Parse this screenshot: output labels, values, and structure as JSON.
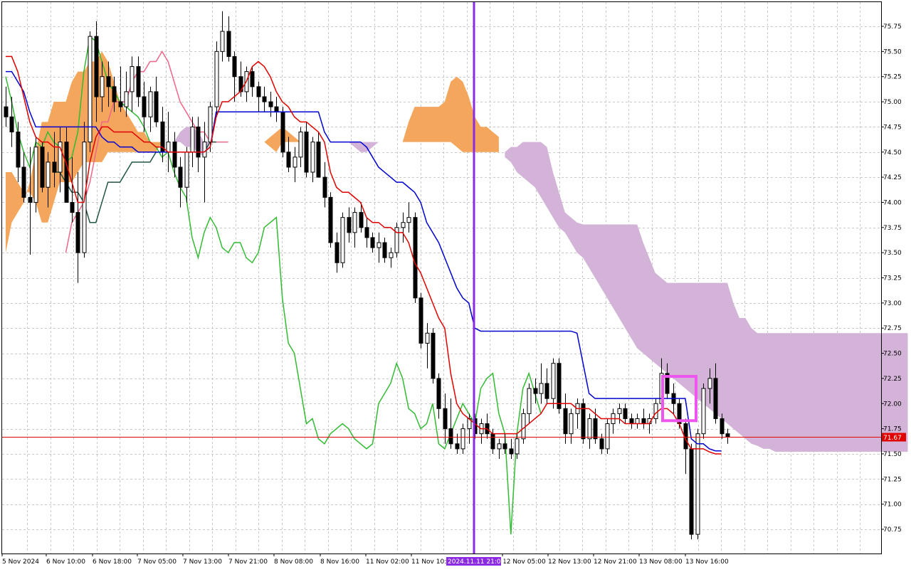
{
  "colors": {
    "background": "#ffffff",
    "grid": "#c8c8c8",
    "tenkan": "#e00000",
    "kijun": "#0000d0",
    "chikou": "#33bb33",
    "senkou_a": "#ee6688",
    "senkou_b": "#225544",
    "kumo_bull": "#f4a65c",
    "kumo_bear": "#d3b4d8",
    "candle_up_body": "#ffffff",
    "candle_down_body": "#000000",
    "candle_outline": "#000000",
    "vertical_marker": "#8a2be2",
    "highlight_box": "#ee55ee",
    "current_price_line": "#e00000",
    "current_price_badge": "#e00000"
  },
  "chart_data": {
    "type": "candlestick",
    "indicator": "Ichimoku Kinko Hyo",
    "ylim": [
      70.55,
      75.95
    ],
    "y_ticks": [
      "75.75",
      "75.50",
      "75.25",
      "75.00",
      "74.75",
      "74.50",
      "74.25",
      "74.00",
      "73.75",
      "73.50",
      "73.25",
      "73.00",
      "72.75",
      "72.50",
      "72.25",
      "72.00",
      "71.75",
      "71.50",
      "71.25",
      "71.00",
      "70.75"
    ],
    "x_ticks": [
      "5 Nov 2024",
      "6 Nov 10:00",
      "6 Nov 18:00",
      "7 Nov 05:00",
      "7 Nov 13:00",
      "7 Nov 21:00",
      "8 Nov 08:00",
      "8 Nov 16:00",
      "11 Nov 02:00",
      "11 Nov 10:00",
      "12 Nov 05:00",
      "12 Nov 13:00",
      "12 Nov 21:00",
      "13 Nov 08:00",
      "13 Nov 16:00"
    ],
    "current_price": "71.67",
    "marker_label": "2024.11.11 21:00",
    "candles": [
      [
        74.95,
        75.15,
        74.75,
        74.85
      ],
      [
        74.85,
        75.05,
        74.55,
        74.7
      ],
      [
        74.7,
        74.8,
        74.2,
        74.35
      ],
      [
        74.35,
        74.5,
        74.0,
        74.05
      ],
      [
        74.05,
        74.55,
        73.48,
        74.0
      ],
      [
        74.0,
        74.65,
        73.9,
        74.55
      ],
      [
        74.55,
        74.6,
        74.1,
        74.15
      ],
      [
        74.15,
        74.5,
        73.95,
        74.4
      ],
      [
        74.4,
        74.7,
        74.15,
        74.3
      ],
      [
        74.3,
        74.75,
        74.1,
        74.6
      ],
      [
        74.6,
        74.75,
        74.05,
        74.0
      ],
      [
        74.0,
        74.45,
        73.8,
        73.9
      ],
      [
        73.9,
        74.3,
        73.2,
        73.5
      ],
      [
        73.5,
        74.8,
        73.45,
        74.6
      ],
      [
        74.6,
        75.7,
        74.5,
        75.65
      ],
      [
        75.65,
        75.8,
        74.8,
        75.05
      ],
      [
        75.05,
        75.4,
        74.9,
        75.25
      ],
      [
        75.25,
        75.4,
        74.95,
        75.15
      ],
      [
        75.15,
        75.25,
        74.9,
        75.0
      ],
      [
        75.0,
        75.35,
        74.9,
        74.95
      ],
      [
        74.95,
        75.3,
        74.85,
        75.1
      ],
      [
        75.1,
        75.45,
        74.9,
        75.35
      ],
      [
        75.35,
        75.45,
        74.95,
        75.05
      ],
      [
        75.05,
        75.2,
        74.7,
        74.85
      ],
      [
        74.85,
        75.15,
        74.7,
        75.1
      ],
      [
        75.1,
        75.25,
        74.75,
        74.8
      ],
      [
        74.8,
        74.95,
        74.4,
        74.5
      ],
      [
        74.5,
        74.9,
        74.3,
        74.6
      ],
      [
        74.6,
        74.7,
        74.25,
        74.35
      ],
      [
        74.35,
        74.45,
        73.95,
        74.15
      ],
      [
        74.15,
        74.55,
        74.0,
        74.5
      ],
      [
        74.5,
        74.85,
        74.35,
        74.75
      ],
      [
        74.75,
        74.85,
        74.3,
        74.45
      ],
      [
        74.45,
        74.8,
        74.0,
        74.6
      ],
      [
        74.6,
        75.0,
        74.5,
        74.95
      ],
      [
        74.95,
        75.6,
        74.85,
        75.5
      ],
      [
        75.5,
        75.9,
        75.4,
        75.7
      ],
      [
        75.7,
        75.85,
        75.4,
        75.45
      ],
      [
        75.45,
        75.5,
        75.0,
        75.25
      ],
      [
        75.25,
        75.4,
        75.05,
        75.1
      ],
      [
        75.1,
        75.35,
        75.0,
        75.3
      ],
      [
        75.3,
        75.35,
        75.05,
        75.15
      ],
      [
        75.15,
        75.2,
        74.9,
        75.05
      ],
      [
        75.05,
        75.15,
        74.9,
        75.0
      ],
      [
        75.0,
        75.1,
        74.85,
        74.95
      ],
      [
        74.95,
        75.05,
        74.8,
        74.9
      ],
      [
        74.9,
        74.95,
        74.45,
        74.5
      ],
      [
        74.5,
        74.65,
        74.3,
        74.35
      ],
      [
        74.35,
        74.55,
        74.2,
        74.45
      ],
      [
        74.45,
        74.75,
        74.35,
        74.7
      ],
      [
        74.7,
        74.8,
        74.25,
        74.3
      ],
      [
        74.3,
        74.65,
        74.2,
        74.6
      ],
      [
        74.6,
        74.7,
        74.25,
        74.25
      ],
      [
        74.25,
        74.4,
        73.95,
        74.05
      ],
      [
        74.05,
        74.1,
        73.55,
        73.6
      ],
      [
        73.6,
        73.7,
        73.3,
        73.4
      ],
      [
        73.4,
        73.9,
        73.35,
        73.85
      ],
      [
        73.85,
        73.95,
        73.6,
        73.7
      ],
      [
        73.7,
        73.95,
        73.55,
        73.9
      ],
      [
        73.9,
        74.0,
        73.7,
        73.75
      ],
      [
        73.75,
        73.85,
        73.55,
        73.65
      ],
      [
        73.65,
        73.7,
        73.5,
        73.55
      ],
      [
        73.55,
        73.7,
        73.4,
        73.6
      ],
      [
        73.6,
        73.65,
        73.4,
        73.45
      ],
      [
        73.45,
        73.55,
        73.35,
        73.5
      ],
      [
        73.5,
        73.8,
        73.45,
        73.75
      ],
      [
        73.75,
        73.9,
        73.6,
        73.8
      ],
      [
        73.8,
        74.0,
        73.7,
        73.85
      ],
      [
        73.85,
        73.9,
        73.0,
        73.05
      ],
      [
        73.05,
        73.1,
        72.55,
        72.6
      ],
      [
        72.6,
        72.8,
        72.35,
        72.7
      ],
      [
        72.7,
        72.75,
        72.2,
        72.25
      ],
      [
        72.25,
        72.3,
        71.85,
        71.95
      ],
      [
        71.95,
        72.1,
        71.6,
        71.75
      ],
      [
        71.75,
        72.05,
        71.55,
        71.6
      ],
      [
        71.6,
        71.7,
        71.5,
        71.55
      ],
      [
        71.55,
        71.8,
        71.5,
        71.75
      ],
      [
        71.75,
        71.9,
        71.6,
        71.85
      ],
      [
        71.85,
        71.9,
        71.65,
        71.7
      ],
      [
        71.7,
        71.85,
        71.6,
        71.8
      ],
      [
        71.8,
        71.9,
        71.65,
        71.7
      ],
      [
        71.7,
        71.75,
        71.5,
        71.55
      ],
      [
        71.55,
        71.65,
        71.45,
        71.6
      ],
      [
        71.6,
        71.7,
        71.5,
        71.55
      ],
      [
        71.55,
        71.65,
        71.45,
        71.5
      ],
      [
        71.5,
        71.7,
        71.45,
        71.65
      ],
      [
        71.65,
        71.95,
        71.6,
        71.9
      ],
      [
        71.9,
        72.2,
        71.8,
        72.15
      ],
      [
        72.15,
        72.25,
        72.0,
        72.1
      ],
      [
        72.1,
        72.4,
        72.0,
        72.2
      ],
      [
        72.2,
        72.35,
        72.0,
        72.05
      ],
      [
        72.05,
        72.45,
        71.95,
        72.4
      ],
      [
        72.4,
        72.45,
        71.9,
        71.95
      ],
      [
        71.95,
        72.1,
        71.6,
        71.7
      ],
      [
        71.7,
        71.95,
        71.6,
        71.9
      ],
      [
        71.9,
        72.05,
        71.75,
        72.0
      ],
      [
        72.0,
        72.05,
        71.6,
        71.65
      ],
      [
        71.65,
        71.9,
        71.55,
        71.85
      ],
      [
        71.85,
        71.95,
        71.6,
        71.65
      ],
      [
        71.65,
        71.7,
        71.5,
        71.55
      ],
      [
        71.55,
        71.85,
        71.5,
        71.8
      ],
      [
        71.8,
        71.95,
        71.7,
        71.9
      ],
      [
        71.9,
        72.0,
        71.8,
        71.95
      ],
      [
        71.95,
        72.0,
        71.8,
        71.85
      ],
      [
        71.85,
        71.9,
        71.75,
        71.8
      ],
      [
        71.8,
        71.9,
        71.75,
        71.85
      ],
      [
        71.85,
        71.95,
        71.75,
        71.8
      ],
      [
        71.8,
        71.9,
        71.7,
        71.85
      ],
      [
        71.85,
        72.05,
        71.8,
        72.0
      ],
      [
        72.0,
        72.45,
        71.95,
        72.3
      ],
      [
        72.3,
        72.4,
        72.05,
        72.1
      ],
      [
        72.1,
        72.2,
        71.9,
        72.0
      ],
      [
        72.0,
        72.05,
        71.75,
        71.8
      ],
      [
        71.8,
        71.85,
        71.3,
        71.55
      ],
      [
        71.55,
        71.6,
        70.65,
        70.7
      ],
      [
        70.7,
        71.75,
        70.65,
        71.7
      ],
      [
        71.7,
        72.2,
        71.65,
        72.15
      ],
      [
        72.15,
        72.35,
        72.0,
        72.25
      ],
      [
        72.25,
        72.4,
        71.8,
        71.85
      ],
      [
        71.85,
        71.9,
        71.65,
        71.7
      ],
      [
        71.7,
        71.75,
        71.6,
        71.67
      ]
    ],
    "tenkan": [
      75.45,
      75.45,
      75.3,
      75.05,
      74.8,
      74.65,
      74.6,
      74.6,
      74.55,
      74.55,
      74.4,
      74.2,
      74.0,
      74.0,
      74.4,
      74.65,
      74.75,
      74.75,
      74.7,
      74.7,
      74.7,
      74.7,
      74.65,
      74.6,
      74.6,
      74.55,
      74.55,
      74.5,
      74.5,
      74.5,
      74.5,
      74.5,
      74.5,
      74.5,
      74.55,
      74.85,
      75.0,
      75.0,
      75.05,
      75.1,
      75.2,
      75.35,
      75.4,
      75.35,
      75.25,
      75.1,
      75.0,
      74.95,
      74.85,
      74.8,
      74.8,
      74.75,
      74.7,
      74.6,
      74.3,
      74.15,
      74.1,
      74.1,
      74.05,
      74.0,
      73.85,
      73.8,
      73.8,
      73.75,
      73.75,
      73.7,
      73.7,
      73.6,
      73.4,
      73.3,
      73.15,
      73.0,
      72.85,
      72.75,
      72.3,
      72.0,
      71.9,
      71.85,
      71.8,
      71.75,
      71.75,
      71.7,
      71.7,
      71.7,
      71.7,
      71.7,
      71.75,
      71.8,
      71.85,
      71.9,
      72.0,
      72.0,
      72.0,
      72.0,
      72.0,
      71.95,
      71.95,
      71.95,
      71.9,
      71.85,
      71.85,
      71.85,
      71.85,
      71.8,
      71.8,
      71.8,
      71.8,
      71.8,
      71.9,
      71.95,
      71.95,
      71.9,
      71.8,
      71.65,
      71.55,
      71.55,
      71.55,
      71.52,
      71.5,
      71.5
    ],
    "kijun": [
      75.3,
      75.3,
      75.2,
      75.1,
      74.9,
      74.75,
      74.75,
      74.75,
      74.75,
      74.75,
      74.75,
      74.75,
      74.75,
      74.75,
      74.75,
      74.75,
      74.65,
      74.6,
      74.6,
      74.55,
      74.55,
      74.55,
      74.5,
      74.5,
      74.5,
      74.5,
      74.5,
      74.5,
      74.5,
      74.5,
      74.5,
      74.5,
      74.5,
      74.5,
      74.55,
      74.9,
      74.9,
      74.9,
      74.9,
      74.9,
      74.9,
      74.9,
      74.9,
      74.9,
      74.9,
      74.9,
      74.9,
      74.9,
      74.9,
      74.9,
      74.9,
      74.9,
      74.9,
      74.7,
      74.6,
      74.6,
      74.6,
      74.6,
      74.6,
      74.6,
      74.55,
      74.45,
      74.35,
      74.3,
      74.25,
      74.2,
      74.2,
      74.15,
      74.1,
      74.0,
      73.8,
      73.7,
      73.6,
      73.45,
      73.3,
      73.15,
      73.05,
      73.0,
      72.75,
      72.72,
      72.72,
      72.72,
      72.72,
      72.72,
      72.72,
      72.72,
      72.72,
      72.72,
      72.72,
      72.72,
      72.72,
      72.72,
      72.72,
      72.72,
      72.72,
      72.7,
      72.4,
      72.1,
      72.05,
      72.05,
      72.05,
      72.05,
      72.05,
      72.05,
      72.05,
      72.05,
      72.05,
      72.05,
      72.05,
      72.05,
      72.05,
      72.05,
      72.05,
      72.05,
      71.65,
      71.6,
      71.6,
      71.55,
      71.53,
      71.53
    ],
    "chikou": [
      75.25,
      75.0,
      74.7,
      74.5,
      74.35,
      74.6,
      74.55,
      74.7,
      74.6,
      74.55,
      74.4,
      74.45,
      74.7,
      75.3,
      75.65,
      75.6,
      75.4,
      75.2,
      75.1,
      75.0,
      74.95,
      74.9,
      74.85,
      74.75,
      74.6,
      74.55,
      74.45,
      74.5,
      74.3,
      74.15,
      74.05,
      73.65,
      73.45,
      73.7,
      73.85,
      73.75,
      73.55,
      73.5,
      73.6,
      73.6,
      73.45,
      73.4,
      73.5,
      73.75,
      73.8,
      73.85,
      73.05,
      72.6,
      72.5,
      72.15,
      71.8,
      71.85,
      71.65,
      71.6,
      71.7,
      71.75,
      71.8,
      71.75,
      71.65,
      71.6,
      71.55,
      71.6,
      72.0,
      72.1,
      72.2,
      72.4,
      72.25,
      71.95,
      71.9,
      71.75,
      71.8,
      72.0,
      71.6,
      71.55,
      71.7,
      71.85,
      72.0,
      71.9,
      71.8,
      72.15,
      72.25,
      72.3,
      71.9,
      71.7,
      70.7,
      71.7,
      72.15,
      72.3,
      72.1,
      71.9
    ]
  },
  "kumo_segments": [
    {
      "x0": 0,
      "points_a": [
        73.5,
        73.8,
        73.9,
        74.0,
        74.2,
        74.5,
        74.8,
        74.8,
        75.0,
        75.0,
        75.0,
        75.2,
        75.3,
        75.3,
        75.4,
        75.4,
        75.5,
        75.4,
        75.2,
        75.0,
        74.9,
        74.8,
        74.7,
        74.7,
        74.6,
        74.6,
        74.6,
        74.6
      ],
      "points_b": [
        74.3,
        74.3,
        74.2,
        74.1,
        74.1,
        74.0,
        73.8,
        73.8,
        74.0,
        74.2,
        74.2,
        74.2,
        74.3,
        74.4,
        74.4,
        74.4,
        74.4,
        74.5,
        74.5,
        74.5,
        74.5,
        74.5,
        74.5,
        74.5,
        74.5,
        74.5,
        74.6,
        74.6
      ],
      "kind": "bull"
    },
    {
      "x0": 28,
      "points_a": [
        74.6,
        74.7,
        74.75,
        74.75,
        74.7,
        74.6,
        74.6,
        74.6,
        74.6,
        74.6,
        74.6,
        74.6
      ],
      "points_b": [
        74.6,
        74.6,
        74.55,
        74.55,
        74.5,
        74.45,
        74.6,
        74.6,
        74.6,
        74.6,
        74.6,
        74.6
      ],
      "kind": "bear"
    },
    {
      "x0": 43,
      "points_a": [
        74.6,
        74.65,
        74.7,
        74.75,
        74.7,
        74.65,
        74.6,
        74.6,
        74.6,
        74.6,
        74.6,
        74.6,
        74.6
      ],
      "points_b": [
        74.6,
        74.55,
        74.5,
        74.6,
        74.6,
        74.6,
        74.6,
        74.6,
        74.6,
        74.6,
        74.6,
        74.6,
        74.6
      ],
      "kind": "bull"
    },
    {
      "x0": 56,
      "points_a": [
        74.6,
        74.6,
        74.55,
        74.5,
        74.5,
        74.55,
        74.6,
        74.6,
        74.6,
        74.6
      ],
      "points_b": [
        74.6,
        74.6,
        74.6,
        74.6,
        74.6,
        74.6,
        74.6,
        74.6,
        74.6,
        74.6
      ],
      "kind": "bear"
    },
    {
      "x0": 66,
      "points_a": [
        74.6,
        74.8,
        74.95,
        74.95,
        74.95,
        74.95,
        74.95,
        75.0,
        75.2,
        75.25,
        75.2,
        75.05,
        74.85,
        74.75,
        74.75,
        74.7,
        74.65
      ],
      "points_b": [
        74.6,
        74.6,
        74.6,
        74.6,
        74.6,
        74.6,
        74.6,
        74.6,
        74.6,
        74.55,
        74.5,
        74.5,
        74.5,
        74.5,
        74.5,
        74.5,
        74.5
      ],
      "kind": "bull"
    },
    {
      "x0": 83,
      "points_a": [
        74.45,
        74.4,
        74.3,
        74.25,
        74.2,
        74.15,
        74.05,
        73.95,
        73.85,
        73.75,
        73.7,
        73.6,
        73.5,
        73.45,
        73.35,
        73.25,
        73.15,
        73.05,
        72.95,
        72.85,
        72.75,
        72.65,
        72.55,
        72.5,
        72.45,
        72.4,
        72.35,
        72.3,
        72.25,
        72.2,
        72.15,
        72.1,
        72.05,
        72.0,
        71.95,
        71.9,
        71.85,
        71.8,
        71.75,
        71.7,
        71.65,
        71.6,
        71.58,
        71.55,
        71.55,
        71.52,
        71.52,
        71.52,
        71.52,
        71.52,
        71.52,
        71.52,
        71.52,
        71.52,
        71.52,
        71.52,
        71.52,
        71.52,
        71.52,
        71.52,
        71.52,
        71.52,
        71.52,
        71.52,
        71.52,
        71.52,
        71.52,
        71.52
      ],
      "points_b": [
        74.5,
        74.55,
        74.55,
        74.6,
        74.6,
        74.6,
        74.6,
        74.55,
        74.3,
        74.1,
        73.9,
        73.85,
        73.8,
        73.78,
        73.78,
        73.78,
        73.78,
        73.78,
        73.78,
        73.78,
        73.78,
        73.78,
        73.78,
        73.6,
        73.45,
        73.3,
        73.25,
        73.2,
        73.2,
        73.2,
        73.2,
        73.2,
        73.2,
        73.2,
        73.2,
        73.2,
        73.2,
        73.2,
        73.0,
        72.85,
        72.85,
        72.75,
        72.7,
        72.7,
        72.7,
        72.7,
        72.7,
        72.7,
        72.7,
        72.7,
        72.7,
        72.7,
        72.7,
        72.7,
        72.7,
        72.7,
        72.7,
        72.7,
        72.7,
        72.7,
        72.7,
        72.7,
        72.7,
        72.7,
        72.7,
        72.7,
        72.7,
        72.7
      ],
      "kind": "bear"
    }
  ]
}
